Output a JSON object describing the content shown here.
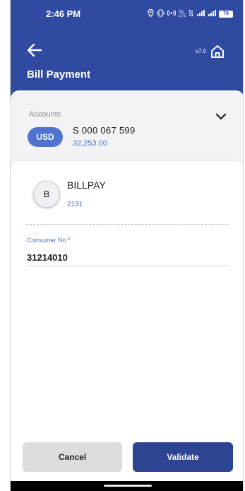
{
  "status_bar": {
    "time": "2:46 PM",
    "icons": [
      "location-icon",
      "vibrate-icon",
      "hotspot-icon",
      "volte-icon",
      "data-arrows-icon",
      "signal-icon",
      "signal-icon",
      "battery-icon"
    ],
    "volte_text": "Vo LTE",
    "battery_text": "79"
  },
  "header": {
    "back_icon": "arrow-left-icon",
    "version": "v7.0",
    "home_icon": "home-icon",
    "title": "Bill Payment",
    "color": "#2f4aa0"
  },
  "accounts": {
    "label": "Accounts",
    "currency": "USD",
    "account_number": "S 000 067 599",
    "balance": "32,253.00",
    "expand_icon": "chevron-down-icon"
  },
  "biller": {
    "initial": "B",
    "name": "BILLPAY",
    "code": "2131"
  },
  "form": {
    "consumer_label": "Consumer No",
    "required_mark": "*",
    "consumer_value": "31214010"
  },
  "actions": {
    "cancel_label": "Cancel",
    "validate_label": "Validate",
    "primary_color": "#2d4493"
  }
}
